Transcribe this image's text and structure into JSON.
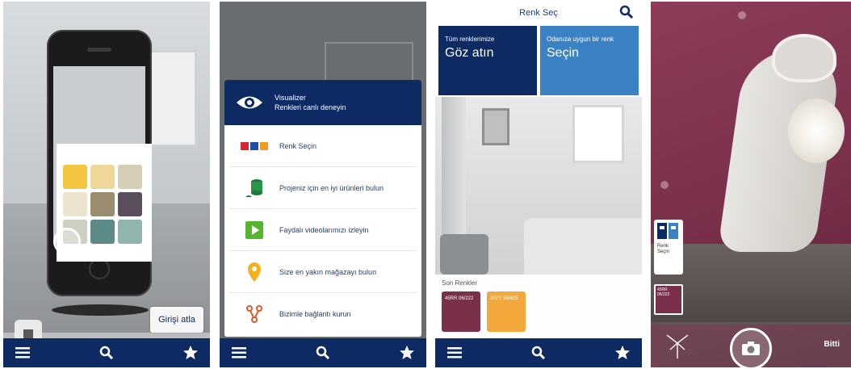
{
  "colors": {
    "navy": "#0e2a63",
    "tile_blue": "#3b82c4",
    "purple_wall": "#7a2f4a"
  },
  "panel1": {
    "skip_label": "Girişi atla",
    "swatches": [
      "#f3c540",
      "#efd79a",
      "#d6cdb6",
      "#ece4cf",
      "#9a8c6e",
      "#5b4f5e",
      "#cfd0c4",
      "#5c8a86",
      "#8fb5ad"
    ]
  },
  "panel2": {
    "header_title": "Visualizer",
    "header_subtitle": "Renkleri canlı deneyin",
    "menu_items": [
      {
        "label": "Renk Seçin",
        "icon": "color-chips-icon"
      },
      {
        "label": "Projeniz için en iyi ürünleri bulun",
        "icon": "paint-can-icon"
      },
      {
        "label": "Faydalı videolarımızı izleyin",
        "icon": "play-icon"
      },
      {
        "label": "Size en yakın mağazayı bulun",
        "icon": "location-pin-icon"
      },
      {
        "label": "Bizimle bağlantı kurun",
        "icon": "share-icon"
      }
    ]
  },
  "panel3": {
    "title": "Renk Seç",
    "tile1_small": "Tüm renklerimize",
    "tile1_big": "Göz atın",
    "tile2_small": "Odanıza uygun bir renk",
    "tile2_big": "Seçin",
    "recent_label": "Son Renkler",
    "recent_chips": [
      {
        "code": "45RR 06/222",
        "color": "#7a2f4a"
      },
      {
        "code": "20YY 56/625",
        "color": "#f3a83b"
      }
    ]
  },
  "panel4": {
    "side_label": "Renk Seçin",
    "swatch_code": "45RR 06/222",
    "done_label": "Bitti"
  }
}
